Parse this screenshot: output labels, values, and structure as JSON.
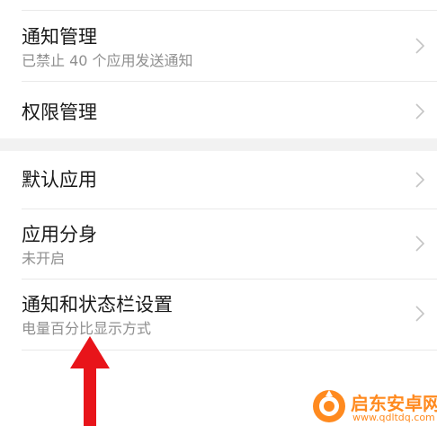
{
  "settings": {
    "items": [
      {
        "title": "通知管理",
        "subtitle": "已禁止 40 个应用发送通知"
      },
      {
        "title": "权限管理"
      },
      {
        "title": "默认应用"
      },
      {
        "title": "应用分身",
        "subtitle": "未开启"
      },
      {
        "title": "通知和状态栏设置",
        "subtitle": "电量百分比显示方式"
      }
    ]
  },
  "watermark": {
    "name": "启东安卓网",
    "url": "www.qdltdq.com"
  },
  "colors": {
    "text_primary": "#1a1a1a",
    "text_secondary": "#8f8f8f",
    "divider": "#e9e9e9",
    "group_gap": "#f2f2f2",
    "chevron": "#c4c4c4",
    "annotation_arrow": "#e8141a",
    "watermark": "#ff8a1f"
  }
}
